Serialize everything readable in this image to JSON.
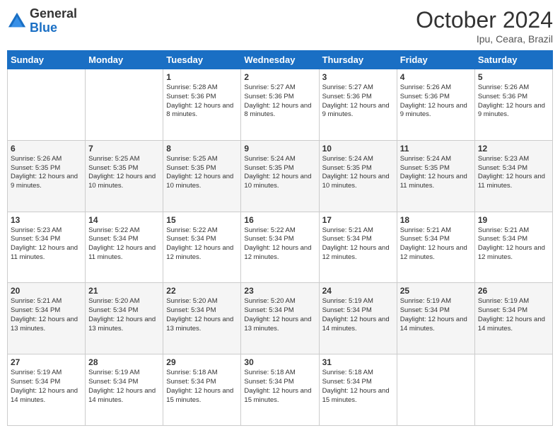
{
  "header": {
    "logo_general": "General",
    "logo_blue": "Blue",
    "month_title": "October 2024",
    "location": "Ipu, Ceara, Brazil"
  },
  "days_of_week": [
    "Sunday",
    "Monday",
    "Tuesday",
    "Wednesday",
    "Thursday",
    "Friday",
    "Saturday"
  ],
  "weeks": [
    [
      {
        "day": "",
        "info": ""
      },
      {
        "day": "",
        "info": ""
      },
      {
        "day": "1",
        "info": "Sunrise: 5:28 AM\nSunset: 5:36 PM\nDaylight: 12 hours and 8 minutes."
      },
      {
        "day": "2",
        "info": "Sunrise: 5:27 AM\nSunset: 5:36 PM\nDaylight: 12 hours and 8 minutes."
      },
      {
        "day": "3",
        "info": "Sunrise: 5:27 AM\nSunset: 5:36 PM\nDaylight: 12 hours and 9 minutes."
      },
      {
        "day": "4",
        "info": "Sunrise: 5:26 AM\nSunset: 5:36 PM\nDaylight: 12 hours and 9 minutes."
      },
      {
        "day": "5",
        "info": "Sunrise: 5:26 AM\nSunset: 5:36 PM\nDaylight: 12 hours and 9 minutes."
      }
    ],
    [
      {
        "day": "6",
        "info": "Sunrise: 5:26 AM\nSunset: 5:35 PM\nDaylight: 12 hours and 9 minutes."
      },
      {
        "day": "7",
        "info": "Sunrise: 5:25 AM\nSunset: 5:35 PM\nDaylight: 12 hours and 10 minutes."
      },
      {
        "day": "8",
        "info": "Sunrise: 5:25 AM\nSunset: 5:35 PM\nDaylight: 12 hours and 10 minutes."
      },
      {
        "day": "9",
        "info": "Sunrise: 5:24 AM\nSunset: 5:35 PM\nDaylight: 12 hours and 10 minutes."
      },
      {
        "day": "10",
        "info": "Sunrise: 5:24 AM\nSunset: 5:35 PM\nDaylight: 12 hours and 10 minutes."
      },
      {
        "day": "11",
        "info": "Sunrise: 5:24 AM\nSunset: 5:35 PM\nDaylight: 12 hours and 11 minutes."
      },
      {
        "day": "12",
        "info": "Sunrise: 5:23 AM\nSunset: 5:34 PM\nDaylight: 12 hours and 11 minutes."
      }
    ],
    [
      {
        "day": "13",
        "info": "Sunrise: 5:23 AM\nSunset: 5:34 PM\nDaylight: 12 hours and 11 minutes."
      },
      {
        "day": "14",
        "info": "Sunrise: 5:22 AM\nSunset: 5:34 PM\nDaylight: 12 hours and 11 minutes."
      },
      {
        "day": "15",
        "info": "Sunrise: 5:22 AM\nSunset: 5:34 PM\nDaylight: 12 hours and 12 minutes."
      },
      {
        "day": "16",
        "info": "Sunrise: 5:22 AM\nSunset: 5:34 PM\nDaylight: 12 hours and 12 minutes."
      },
      {
        "day": "17",
        "info": "Sunrise: 5:21 AM\nSunset: 5:34 PM\nDaylight: 12 hours and 12 minutes."
      },
      {
        "day": "18",
        "info": "Sunrise: 5:21 AM\nSunset: 5:34 PM\nDaylight: 12 hours and 12 minutes."
      },
      {
        "day": "19",
        "info": "Sunrise: 5:21 AM\nSunset: 5:34 PM\nDaylight: 12 hours and 12 minutes."
      }
    ],
    [
      {
        "day": "20",
        "info": "Sunrise: 5:21 AM\nSunset: 5:34 PM\nDaylight: 12 hours and 13 minutes."
      },
      {
        "day": "21",
        "info": "Sunrise: 5:20 AM\nSunset: 5:34 PM\nDaylight: 12 hours and 13 minutes."
      },
      {
        "day": "22",
        "info": "Sunrise: 5:20 AM\nSunset: 5:34 PM\nDaylight: 12 hours and 13 minutes."
      },
      {
        "day": "23",
        "info": "Sunrise: 5:20 AM\nSunset: 5:34 PM\nDaylight: 12 hours and 13 minutes."
      },
      {
        "day": "24",
        "info": "Sunrise: 5:19 AM\nSunset: 5:34 PM\nDaylight: 12 hours and 14 minutes."
      },
      {
        "day": "25",
        "info": "Sunrise: 5:19 AM\nSunset: 5:34 PM\nDaylight: 12 hours and 14 minutes."
      },
      {
        "day": "26",
        "info": "Sunrise: 5:19 AM\nSunset: 5:34 PM\nDaylight: 12 hours and 14 minutes."
      }
    ],
    [
      {
        "day": "27",
        "info": "Sunrise: 5:19 AM\nSunset: 5:34 PM\nDaylight: 12 hours and 14 minutes."
      },
      {
        "day": "28",
        "info": "Sunrise: 5:19 AM\nSunset: 5:34 PM\nDaylight: 12 hours and 14 minutes."
      },
      {
        "day": "29",
        "info": "Sunrise: 5:18 AM\nSunset: 5:34 PM\nDaylight: 12 hours and 15 minutes."
      },
      {
        "day": "30",
        "info": "Sunrise: 5:18 AM\nSunset: 5:34 PM\nDaylight: 12 hours and 15 minutes."
      },
      {
        "day": "31",
        "info": "Sunrise: 5:18 AM\nSunset: 5:34 PM\nDaylight: 12 hours and 15 minutes."
      },
      {
        "day": "",
        "info": ""
      },
      {
        "day": "",
        "info": ""
      }
    ]
  ]
}
